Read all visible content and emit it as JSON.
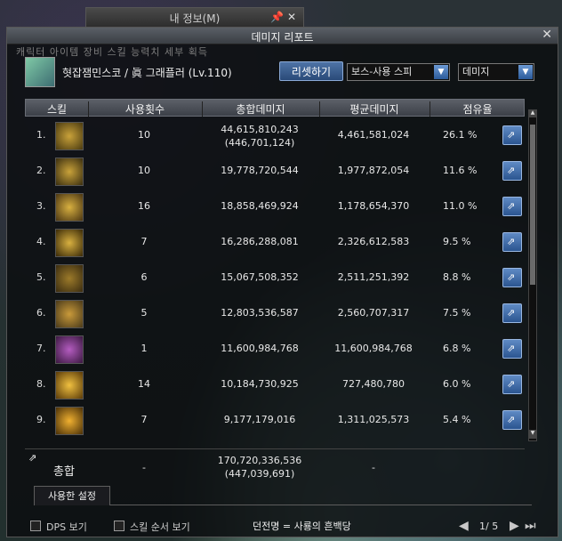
{
  "background_window": {
    "title": "내 정보(M)"
  },
  "window": {
    "title": "데미지 리포트"
  },
  "background_tabs": "캐릭터 아이템 장비 스킬 능력치 세부 획득",
  "character": {
    "name": "혓잡잼민스코 / 眞 그래플러 (Lv.110)"
  },
  "controls": {
    "reset_label": "리셋하기",
    "target_dropdown": "보스-사용 스피",
    "metric_dropdown": "데미지"
  },
  "table": {
    "headers": {
      "skill": "스킬",
      "uses": "사용횟수",
      "total": "총합데미지",
      "avg": "평균데미지",
      "share": "점유율"
    },
    "rows": [
      {
        "num": "1.",
        "uses": "10",
        "total": "44,615,810,243",
        "total_sub": "(446,701,124)",
        "avg": "4,461,581,024",
        "share": "26.1 %"
      },
      {
        "num": "2.",
        "uses": "10",
        "total": "19,778,720,544",
        "total_sub": "",
        "avg": "1,977,872,054",
        "share": "11.6 %"
      },
      {
        "num": "3.",
        "uses": "16",
        "total": "18,858,469,924",
        "total_sub": "",
        "avg": "1,178,654,370",
        "share": "11.0 %"
      },
      {
        "num": "4.",
        "uses": "7",
        "total": "16,286,288,081",
        "total_sub": "",
        "avg": "2,326,612,583",
        "share": "9.5 %"
      },
      {
        "num": "5.",
        "uses": "6",
        "total": "15,067,508,352",
        "total_sub": "",
        "avg": "2,511,251,392",
        "share": "8.8 %"
      },
      {
        "num": "6.",
        "uses": "5",
        "total": "12,803,536,587",
        "total_sub": "",
        "avg": "2,560,707,317",
        "share": "7.5 %"
      },
      {
        "num": "7.",
        "uses": "1",
        "total": "11,600,984,768",
        "total_sub": "",
        "avg": "11,600,984,768",
        "share": "6.8 %"
      },
      {
        "num": "8.",
        "uses": "14",
        "total": "10,184,730,925",
        "total_sub": "",
        "avg": "727,480,780",
        "share": "6.0 %"
      },
      {
        "num": "9.",
        "uses": "7",
        "total": "9,177,179,016",
        "total_sub": "",
        "avg": "1,311,025,573",
        "share": "5.4 %"
      }
    ],
    "total_row": {
      "label": "총합",
      "uses": "-",
      "total": "170,720,336,536",
      "total_sub": "(447,039,691)",
      "avg": "-"
    }
  },
  "tab_used": "사용한 설정",
  "bottom": {
    "dps_label": "DPS 보기",
    "order_label": "스킬 순서 보기",
    "dungeon": "던전명 = 사룡의 흔백당",
    "page": "1/ 5"
  },
  "colors": {
    "accent": "#3a6aa8"
  },
  "icons": {
    "share": "share-icon",
    "close": "close-icon",
    "pin": "pin-icon"
  }
}
